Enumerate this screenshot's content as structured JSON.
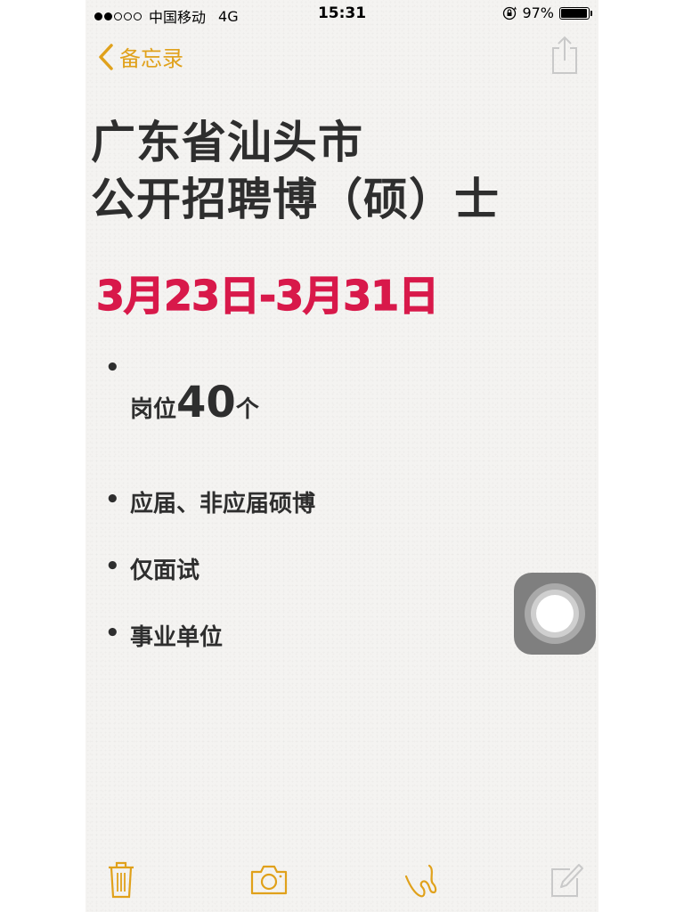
{
  "status_bar": {
    "carrier": "中国移动",
    "network": "4G",
    "time": "15:31",
    "battery_percent": "97%",
    "battery_level": 0.97,
    "signal_bars_filled": 2,
    "signal_bars_total": 5
  },
  "nav": {
    "back_label": "备忘录"
  },
  "note": {
    "title_line1": "广东省汕头市",
    "title_line2": "公开招聘博（硕）士",
    "date_range": "3月23日-3月31日",
    "bullet_char": "•",
    "item1_prefix": "岗位",
    "item1_number": "40",
    "item1_suffix": "个",
    "item2": "应届、非应届硕博",
    "item3": "仅面试",
    "item4": "事业单位"
  },
  "colors": {
    "accent": "#e0a11b",
    "date_red": "#d8194a",
    "text": "#2e2e2e",
    "paper": "#f4f3f1"
  },
  "icons": {
    "back": "chevron-left-icon",
    "share": "share-icon",
    "trash": "trash-icon",
    "camera": "camera-icon",
    "sketch": "sketch-icon",
    "compose": "compose-icon",
    "lock": "orientation-lock-icon",
    "assistive": "assistive-touch-icon"
  }
}
